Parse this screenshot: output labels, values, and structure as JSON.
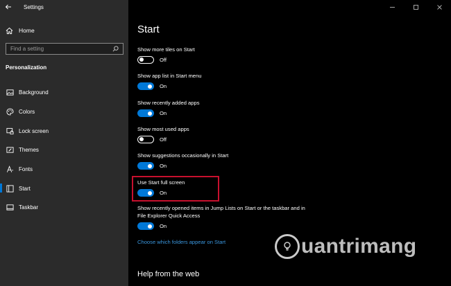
{
  "window": {
    "title": "Settings",
    "controls": [
      "minimize",
      "maximize",
      "close"
    ]
  },
  "sidebar": {
    "home_label": "Home",
    "search_placeholder": "Find a setting",
    "section": "Personalization",
    "items": [
      {
        "label": "Background",
        "icon": "image-icon",
        "active": false
      },
      {
        "label": "Colors",
        "icon": "palette-icon",
        "active": false
      },
      {
        "label": "Lock screen",
        "icon": "lock-screen-icon",
        "active": false
      },
      {
        "label": "Themes",
        "icon": "brush-icon",
        "active": false
      },
      {
        "label": "Fonts",
        "icon": "font-icon",
        "active": false
      },
      {
        "label": "Start",
        "icon": "start-icon",
        "active": true
      },
      {
        "label": "Taskbar",
        "icon": "taskbar-icon",
        "active": false
      }
    ]
  },
  "main": {
    "title": "Start",
    "settings": [
      {
        "label": "Show more tiles on Start",
        "state": "Off"
      },
      {
        "label": "Show app list in Start menu",
        "state": "On"
      },
      {
        "label": "Show recently added apps",
        "state": "On"
      },
      {
        "label": "Show most used apps",
        "state": "Off"
      },
      {
        "label": "Show suggestions occasionally in Start",
        "state": "On"
      },
      {
        "label": "Use Start full screen",
        "state": "On"
      },
      {
        "label_line1": "Show recently opened items in Jump Lists on Start or the taskbar and in",
        "label_line2": "File Explorer Quick Access",
        "state": "On"
      }
    ],
    "link": "Choose which folders appear on Start",
    "help_title": "Help from the web"
  },
  "watermark": {
    "text": "uantrimang"
  },
  "colors": {
    "accent": "#0078d7",
    "link": "#3a96dd",
    "highlight": "#c8102e",
    "sidebar_bg": "#2b2b2b",
    "main_bg": "#000000"
  }
}
